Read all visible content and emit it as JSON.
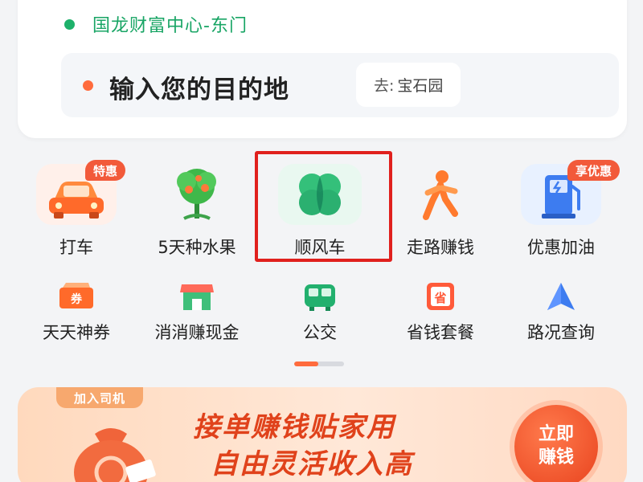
{
  "route": {
    "from_label": "国龙财富中心-东门",
    "dest_prompt": "输入您的目的地",
    "suggest_prefix": "去:",
    "suggest_place": "宝石园"
  },
  "grid": {
    "row1": [
      {
        "label": "打车",
        "badge": "特惠"
      },
      {
        "label": "5天种水果"
      },
      {
        "label": "顺风车"
      },
      {
        "label": "走路赚钱"
      },
      {
        "label": "优惠加油",
        "badge": "享优惠"
      }
    ],
    "row2": [
      {
        "label": "天天神券"
      },
      {
        "label": "消消赚现金"
      },
      {
        "label": "公交"
      },
      {
        "label": "省钱套餐"
      },
      {
        "label": "路况查询"
      }
    ]
  },
  "banner": {
    "tag": "加入司机",
    "line1": "接单赚钱贴家用",
    "line2": "自由灵活收入高",
    "button_line1": "立即",
    "button_line2": "赚钱"
  },
  "colors": {
    "accent_green": "#1db16a",
    "accent_orange": "#ff6b3d",
    "highlight_red": "#e0201d"
  }
}
